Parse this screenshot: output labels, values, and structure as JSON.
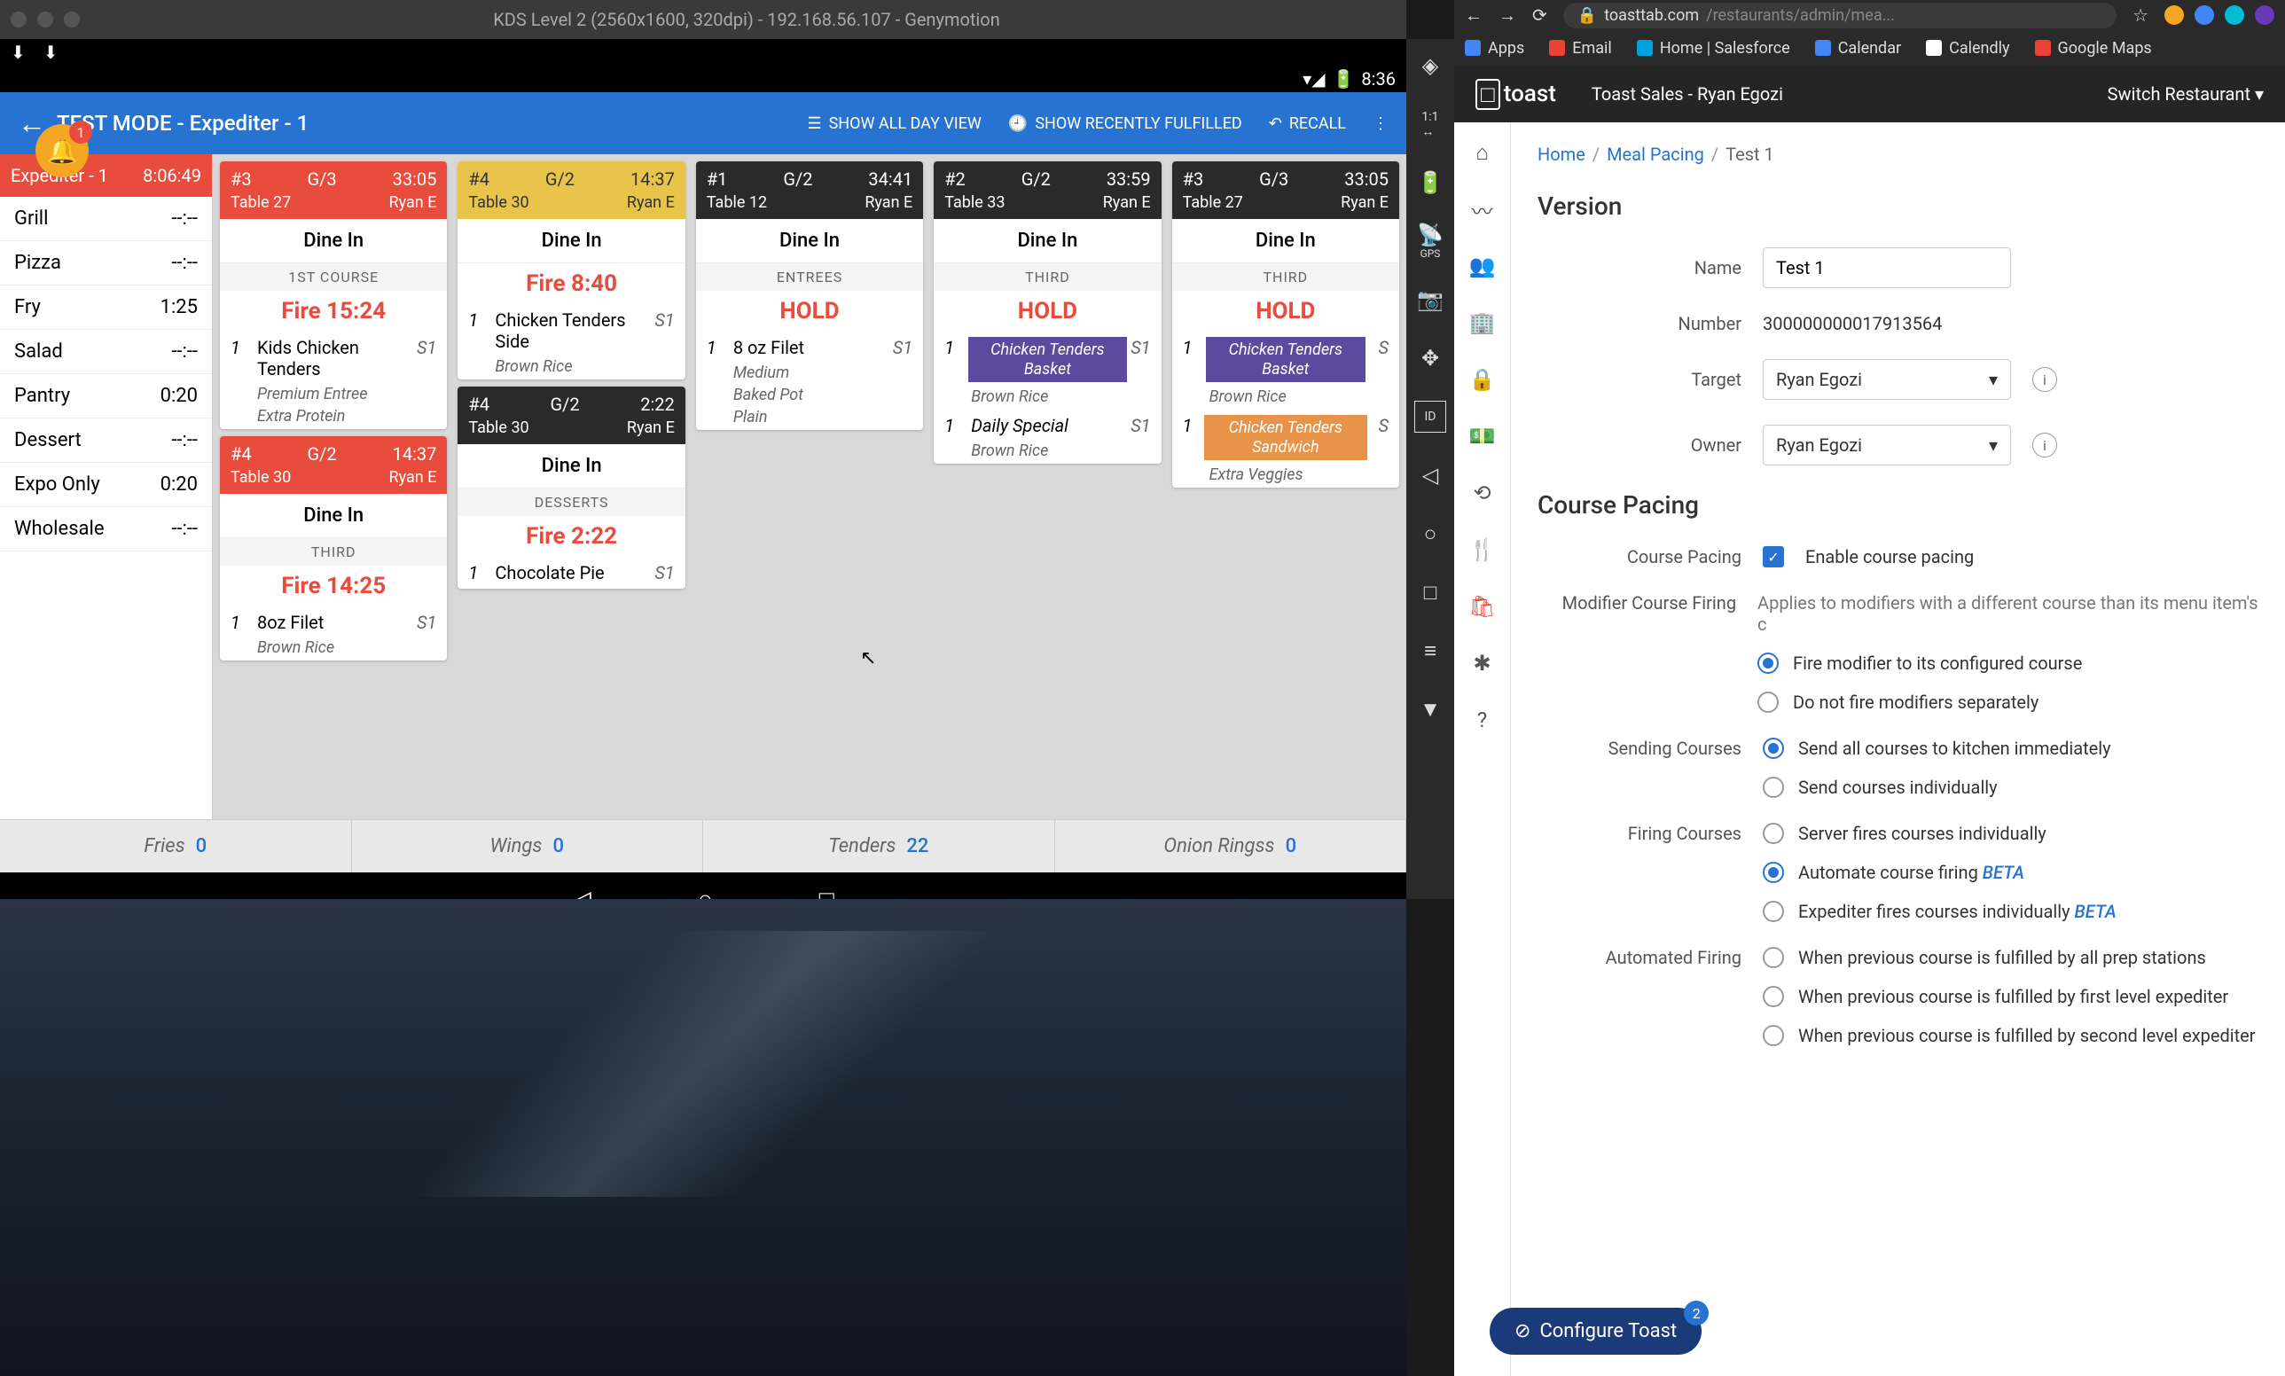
{
  "mac": {
    "title": "KDS Level 2 (2560x1600, 320dpi) - 192.168.56.107 - Genymotion"
  },
  "status": {
    "time": "8:36"
  },
  "appbar": {
    "title": "TEST MODE - Expediter - 1",
    "show_all": "SHOW ALL DAY VIEW",
    "show_recent": "SHOW RECENTLY FULFILLED",
    "recall": "RECALL"
  },
  "bell": {
    "count": "1"
  },
  "sidebar": {
    "head_left": "Expediter - 1",
    "head_right": "8:06:49",
    "rows": [
      {
        "name": "Grill",
        "time": "--:--"
      },
      {
        "name": "Pizza",
        "time": "--:--"
      },
      {
        "name": "Fry",
        "time": "1:25"
      },
      {
        "name": "Salad",
        "time": "--:--"
      },
      {
        "name": "Pantry",
        "time": "0:20"
      },
      {
        "name": "Dessert",
        "time": "--:--"
      },
      {
        "name": "Expo Only",
        "time": "0:20"
      },
      {
        "name": "Wholesale",
        "time": "--:--"
      }
    ]
  },
  "tickets": {
    "col1": [
      {
        "num": "#3",
        "g": "G/3",
        "time": "33:05",
        "table": "Table 27",
        "user": "Ryan E",
        "head": "red",
        "dine": "Dine In",
        "course": "1ST COURSE",
        "fire": "Fire  15:24",
        "items": [
          {
            "q": "1",
            "n": "Kids Chicken Tenders",
            "s": "S1"
          }
        ],
        "mods": [
          "Premium Entree",
          "Extra Protein"
        ]
      },
      {
        "num": "#4",
        "g": "G/2",
        "time": "14:37",
        "table": "Table 30",
        "user": "Ryan E",
        "head": "red",
        "dine": "Dine In",
        "course": "THIRD",
        "fire": "Fire  14:25",
        "items": [
          {
            "q": "1",
            "n": "8oz Filet",
            "s": "S1"
          }
        ],
        "mods": [
          "Brown Rice"
        ]
      }
    ],
    "col2": [
      {
        "num": "#4",
        "g": "G/2",
        "time": "14:37",
        "table": "Table 30",
        "user": "Ryan E",
        "head": "yellow",
        "dine": "Dine In",
        "fire": "Fire  8:40",
        "items": [
          {
            "q": "1",
            "n": "Chicken Tenders Side",
            "s": "S1"
          }
        ],
        "mods": [
          "Brown Rice"
        ]
      },
      {
        "num": "#4",
        "g": "G/2",
        "time": "2:22",
        "table": "Table 30",
        "user": "Ryan E",
        "head": "dark",
        "dine": "Dine In",
        "course": "DESSERTS",
        "fire": "Fire  2:22",
        "items": [
          {
            "q": "1",
            "n": "Chocolate Pie",
            "s": "S1"
          }
        ]
      }
    ],
    "col3": [
      {
        "num": "#1",
        "g": "G/2",
        "time": "34:41",
        "table": "Table 12",
        "user": "Ryan E",
        "head": "dark",
        "dine": "Dine In",
        "course": "ENTREES",
        "hold": "HOLD",
        "items": [
          {
            "q": "1",
            "n": "8 oz Filet",
            "s": "S1"
          }
        ],
        "mods": [
          "Medium",
          "Baked Pot",
          "Plain"
        ]
      }
    ],
    "col4": [
      {
        "num": "#2",
        "g": "G/2",
        "time": "33:59",
        "table": "Table 33",
        "user": "Ryan E",
        "head": "dark",
        "dine": "Dine In",
        "course": "THIRD",
        "hold": "HOLD",
        "chips": [
          {
            "q": "1",
            "t": "Chicken Tenders Basket",
            "c": "purple",
            "s": "S1"
          }
        ],
        "mods": [
          "Brown Rice"
        ],
        "items2": [
          {
            "q": "1",
            "n": "Daily Special",
            "s": "S1"
          }
        ],
        "mods2": [
          "Brown Rice"
        ]
      }
    ],
    "col5": [
      {
        "num": "#3",
        "g": "G/3",
        "time": "33:05",
        "table": "Table 27",
        "user": "Ryan E",
        "head": "dark",
        "dine": "Dine In",
        "course": "THIRD",
        "hold": "HOLD",
        "chips": [
          {
            "q": "1",
            "t": "Chicken Tenders Basket",
            "c": "purple",
            "s": "S"
          }
        ],
        "mods": [
          "Brown Rice"
        ],
        "chips2": [
          {
            "q": "1",
            "t": "Chicken Tenders Sandwich",
            "c": "orange",
            "s": "S"
          }
        ],
        "mods2": [
          "Extra Veggies"
        ]
      }
    ]
  },
  "footer": [
    {
      "name": "Fries",
      "count": "0"
    },
    {
      "name": "Wings",
      "count": "0"
    },
    {
      "name": "Tenders",
      "count": "22"
    },
    {
      "name": "Onion Ringss",
      "count": "0"
    }
  ],
  "edge": {
    "gps": "GPS",
    "id": "ID"
  },
  "chrome": {
    "url_host": "toasttab.com",
    "url_path": "/restaurants/admin/mea...",
    "bookmarks": [
      {
        "label": "Apps",
        "color": "#4285f4"
      },
      {
        "label": "Email",
        "color": "#ea4335"
      },
      {
        "label": "Home | Salesforce",
        "color": "#00a1e0"
      },
      {
        "label": "Calendar",
        "color": "#4285f4"
      },
      {
        "label": "Calendly",
        "color": "#fff"
      },
      {
        "label": "Google Maps",
        "color": "#ea4335"
      }
    ]
  },
  "toast": {
    "logo": "toast",
    "sales": "Toast Sales - Ryan Egozi",
    "switch": "Switch Restaurant",
    "breadcrumb": {
      "home": "Home",
      "mp": "Meal Pacing",
      "cur": "Test 1"
    },
    "version": "Version",
    "name_lbl": "Name",
    "name_val": "Test 1",
    "num_lbl": "Number",
    "num_val": "300000000017913564",
    "target_lbl": "Target",
    "target_val": "Ryan Egozi",
    "owner_lbl": "Owner",
    "owner_val": "Ryan Egozi",
    "cp_h": "Course Pacing",
    "cp_lbl": "Course Pacing",
    "cp_chk": "Enable course pacing",
    "mcf_lbl": "Modifier Course Firing",
    "mcf_help": "Applies to modifiers with a different course than its menu item's c",
    "mcf_r1": "Fire modifier to its configured course",
    "mcf_r2": "Do not fire modifiers separately",
    "sc_lbl": "Sending Courses",
    "sc_r1": "Send all courses to kitchen immediately",
    "sc_r2": "Send courses individually",
    "fc_lbl": "Firing Courses",
    "fc_r1": "Server fires courses individually",
    "fc_r2": "Automate course firing ",
    "fc_r3": "Expediter fires courses individually ",
    "beta": "BETA",
    "af_lbl": "Automated Firing",
    "af_r1": "When previous course is fulfilled by all prep stations",
    "af_r2": "When previous course is fulfilled by first level expediter",
    "af_r3": "When previous course is fulfilled by second level expediter",
    "config": "Configure Toast",
    "config_badge": "2"
  }
}
